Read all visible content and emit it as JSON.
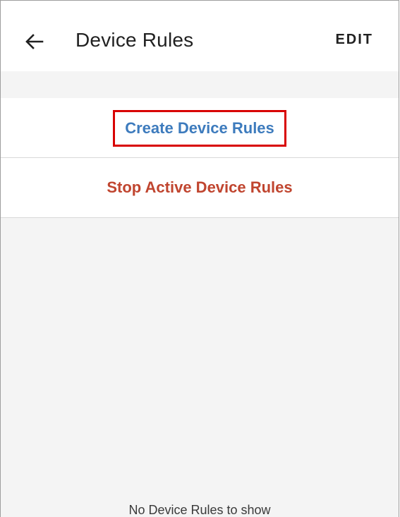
{
  "app_bar": {
    "back_icon": "arrow-left-icon",
    "title": "Device Rules",
    "edit_label": "EDIT"
  },
  "actions": {
    "create_label": "Create Device Rules",
    "stop_label": "Stop Active Device Rules"
  },
  "empty_state": {
    "message": "No Device Rules to show"
  },
  "colors": {
    "create_text": "#3d7bbd",
    "stop_text": "#c0452f",
    "highlight_box": "#d80000",
    "background_gray": "#f4f4f4"
  }
}
